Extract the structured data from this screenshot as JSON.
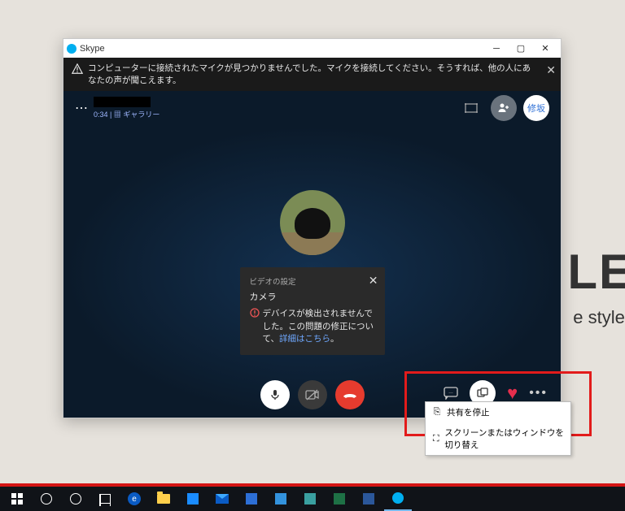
{
  "bg": {
    "big": "LE",
    "small": "e style."
  },
  "window": {
    "title": "Skype",
    "alert": {
      "text": "コンピューターに接続されたマイクが見つかりませんでした。マイクを接続してください。そうすれば、他の人にあなたの声が聞こえます。"
    },
    "header": {
      "duration": "0:34",
      "gallery_label": "ギャラリー",
      "avatar_badge": "修坂"
    },
    "video_panel": {
      "subtitle": "ビデオの設定",
      "title": "カメラ",
      "error_text": "デバイスが検出されませんでした。この問題の修正について、",
      "error_link": "詳細はこちら",
      "error_suffix": "。"
    }
  },
  "share_menu": {
    "items": [
      {
        "icon": "⎘",
        "label": "共有を停止"
      },
      {
        "icon": "⛶",
        "label": "スクリーンまたはウィンドウを切り替え"
      }
    ]
  },
  "taskbar": {
    "items": [
      "start",
      "search",
      "cortana",
      "taskview",
      "edge",
      "folder",
      "store",
      "mail",
      "app1",
      "app2",
      "app3",
      "excel",
      "word",
      "skype"
    ]
  }
}
